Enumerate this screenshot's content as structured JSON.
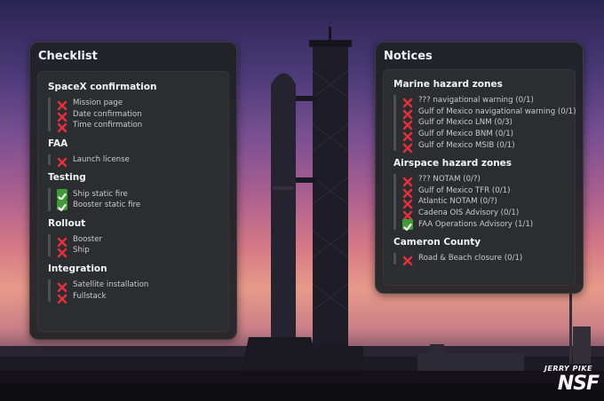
{
  "checklist": {
    "title": "Checklist",
    "sections": [
      {
        "title": "SpaceX confirmation",
        "items": [
          {
            "label": "Mission page",
            "status": "x"
          },
          {
            "label": "Date confirmation",
            "status": "x"
          },
          {
            "label": "Time confirmation",
            "status": "x"
          }
        ]
      },
      {
        "title": "FAA",
        "items": [
          {
            "label": "Launch license",
            "status": "x"
          }
        ]
      },
      {
        "title": "Testing",
        "items": [
          {
            "label": "Ship static fire",
            "status": "check"
          },
          {
            "label": "Booster static fire",
            "status": "check"
          }
        ]
      },
      {
        "title": "Rollout",
        "items": [
          {
            "label": "Booster",
            "status": "x"
          },
          {
            "label": "Ship",
            "status": "x"
          }
        ]
      },
      {
        "title": "Integration",
        "items": [
          {
            "label": "Satellite installation",
            "status": "x"
          },
          {
            "label": "Fullstack",
            "status": "x"
          }
        ]
      }
    ]
  },
  "notices": {
    "title": "Notices",
    "sections": [
      {
        "title": "Marine hazard zones",
        "items": [
          {
            "label": "??? navigational warning (0/1)",
            "status": "x"
          },
          {
            "label": "Gulf of Mexico navigational warning (0/1)",
            "status": "x"
          },
          {
            "label": "Gulf of Mexico LNM (0/3)",
            "status": "x"
          },
          {
            "label": "Gulf of Mexico BNM (0/1)",
            "status": "x"
          },
          {
            "label": "Gulf of Mexico MSIB (0/1)",
            "status": "x"
          }
        ]
      },
      {
        "title": "Airspace hazard zones",
        "items": [
          {
            "label": "??? NOTAM (0/?)",
            "status": "x"
          },
          {
            "label": "Gulf of Mexico TFR (0/1)",
            "status": "x"
          },
          {
            "label": "Atlantic NOTAM (0/?)",
            "status": "x"
          },
          {
            "label": "Cadena OIS Advisory (0/1)",
            "status": "x"
          },
          {
            "label": "FAA Operations Advisory (1/1)",
            "status": "check"
          }
        ]
      },
      {
        "title": "Cameron County",
        "items": [
          {
            "label": "Road & Beach closure (0/1)",
            "status": "x"
          }
        ]
      }
    ]
  },
  "watermark": {
    "name": "JERRY PIKE",
    "logo": "NSF"
  },
  "icons": {
    "x": "cross-icon",
    "check": "check-icon"
  },
  "colors": {
    "cross": "#e0313c",
    "check": "#3f9c35",
    "panel": "#202125",
    "inner": "#2b2d31"
  }
}
